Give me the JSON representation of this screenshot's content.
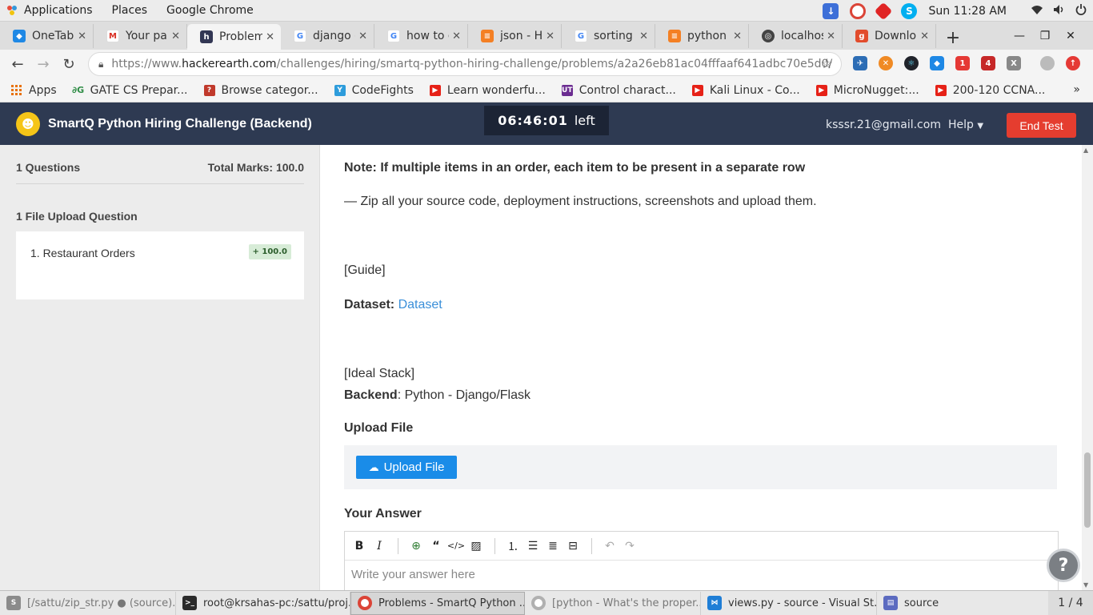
{
  "system_bar": {
    "menus": [
      "Applications",
      "Places",
      "Google Chrome"
    ],
    "clock": "Sun 11:28 AM"
  },
  "tabs": [
    {
      "title": "OneTab",
      "icon": "onetab-icon",
      "color": "#1e88e5",
      "active": false
    },
    {
      "title": "Your par",
      "icon": "gmail-icon",
      "color": "#d93025",
      "active": false
    },
    {
      "title": "Problem",
      "icon": "hackerearth-icon",
      "color": "#323754",
      "active": true
    },
    {
      "title": "django c",
      "icon": "google-icon",
      "color": "#4285f4",
      "active": false
    },
    {
      "title": "how to c",
      "icon": "google-icon",
      "color": "#4285f4",
      "active": false
    },
    {
      "title": "json - H",
      "icon": "stackoverflow-icon",
      "color": "#f48024",
      "active": false
    },
    {
      "title": "sorting l",
      "icon": "google-icon",
      "color": "#4285f4",
      "active": false
    },
    {
      "title": "python -",
      "icon": "stackoverflow-icon",
      "color": "#f48024",
      "active": false
    },
    {
      "title": "localhos",
      "icon": "globe-icon",
      "color": "#444444",
      "active": false
    },
    {
      "title": "Downlo",
      "icon": "download-site-icon",
      "color": "#e24c2c",
      "active": false
    }
  ],
  "omnibox": {
    "url_prefix": "https://www.",
    "url_host": "hackerearth.com",
    "url_path": "/challenges/hiring/smartq-python-hiring-challenge/problems/a2a26eb81ac04fffaaf641adbc70e5d0/"
  },
  "bookmarks": [
    {
      "label": "Apps",
      "icon": "apps-grid-icon",
      "color": "#e8710a"
    },
    {
      "label": "GATE CS Prepar...",
      "icon": "geeksforgeeks-icon",
      "color": "#2f8d46"
    },
    {
      "label": "Browse categor...",
      "icon": "question-icon",
      "color": "#c0392b"
    },
    {
      "label": "CodeFights",
      "icon": "codefights-icon",
      "color": "#2d9cdb"
    },
    {
      "label": "Learn wonderfu...",
      "icon": "youtube-icon",
      "color": "#e62117"
    },
    {
      "label": "Control charact...",
      "icon": "ut-icon",
      "color": "#6b2c91"
    },
    {
      "label": "Kali Linux - Co...",
      "icon": "youtube-icon",
      "color": "#e62117"
    },
    {
      "label": "MicroNugget:...",
      "icon": "youtube-icon",
      "color": "#e62117"
    },
    {
      "label": "200-120 CCNA...",
      "icon": "youtube-icon",
      "color": "#e62117"
    }
  ],
  "header": {
    "title": "SmartQ Python Hiring Challenge (Backend)",
    "timer": "06:46:01",
    "timer_suffix": "left",
    "email": "ksssr.21@gmail.com",
    "help": "Help",
    "end_test": "End Test"
  },
  "sidebar": {
    "questions_count": "1 Questions",
    "total_marks": "Total Marks: 100.0",
    "section_title": "1 File Upload Question",
    "question": {
      "label": "1. Restaurant Orders",
      "marks": "+ 100.0"
    }
  },
  "content": {
    "note": "Note: If multiple items in an order, each item to be present in a separate row",
    "zip_instruction": "— Zip all your source code, deployment instructions, screenshots and upload them.",
    "guide_heading": "[Guide]",
    "dataset_label": "Dataset:",
    "dataset_link": "Dataset",
    "stack_heading": "[Ideal Stack]",
    "backend_label": "Backend",
    "backend_value": ": Python - Django/Flask",
    "upload_heading": "Upload File",
    "upload_button": "Upload File",
    "answer_heading": "Your Answer",
    "answer_placeholder": "Write your answer here"
  },
  "taskbar": [
    {
      "label": "[/sattu/zip_str.py ● (source)...",
      "icon": "sublime-icon",
      "color": "#8b8b8b",
      "grey": true
    },
    {
      "label": "root@krsahas-pc:/sattu/proj...",
      "icon": "terminal-icon",
      "color": "#2b2b2b",
      "grey": false
    },
    {
      "label": "Problems - SmartQ Python ...",
      "icon": "chrome-icon",
      "color": "#4285f4",
      "grey": false,
      "active": true
    },
    {
      "label": "[python - What's the proper...",
      "icon": "chrome-icon",
      "color": "#9aa0a6",
      "grey": true
    },
    {
      "label": "views.py - source - Visual St...",
      "icon": "vscode-icon",
      "color": "#1f7ed6",
      "grey": false
    },
    {
      "label": "source",
      "icon": "folder-icon",
      "color": "#5c6bc0",
      "grey": false
    }
  ],
  "workspace_pager": "1 / 4"
}
